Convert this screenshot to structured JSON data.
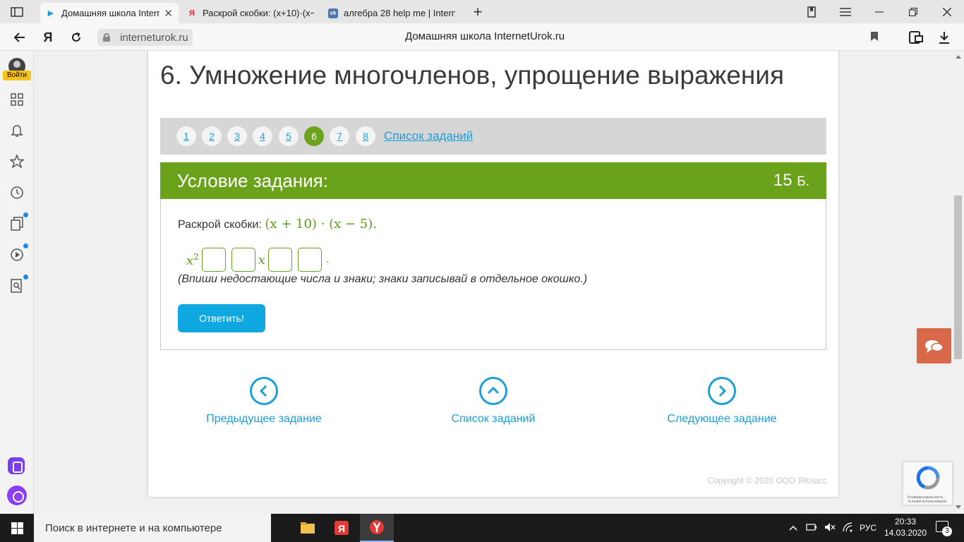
{
  "browser": {
    "tabs": [
      {
        "title": "Домашняя школа Intern",
        "favicon": "play-icon",
        "active": true
      },
      {
        "title": "Раскрой скобки: (x+10)·(x−",
        "favicon": "yandex-icon",
        "active": false
      },
      {
        "title": "алгебра 28 help me | Intern",
        "favicon": "vk-icon",
        "active": false
      }
    ],
    "url": "interneturok.ru",
    "page_title": "Домашняя школа InternetUrok.ru"
  },
  "sidebar": {
    "login_label": "Войти"
  },
  "lesson": {
    "title": "6. Умножение многочленов, упрощение выражения",
    "pages": [
      "1",
      "2",
      "3",
      "4",
      "5",
      "6",
      "7",
      "8"
    ],
    "active_page": "6",
    "task_list_link": "Список заданий"
  },
  "task": {
    "header": "Условие задания:",
    "points_value": "15",
    "points_unit": "Б.",
    "prompt": "Раскрой скобки:",
    "expression": "(x + 10) · (x − 5).",
    "answer_lead_var": "x",
    "answer_lead_exp": "2",
    "answer_mid_var": "x",
    "answer_end": ".",
    "hint": "(Впиши недостающие числа и знаки; знаки записывай в отдельное окошко.)",
    "submit_label": "Ответить!"
  },
  "bottom_nav": {
    "prev": "Предыдущее задание",
    "list": "Список заданий",
    "next": "Следующее задание"
  },
  "copyright": "Copyright © 2020 ООО ЯКласс",
  "recaptcha_text": "Конфиденциальность - Условия использования",
  "taskbar": {
    "search_placeholder": "Поиск в интернете и на компьютере",
    "lang": "РУС",
    "time": "20:33",
    "date": "14.03.2020",
    "notifications": "3"
  },
  "colors": {
    "accent_green": "#6aa21b",
    "link_blue": "#1c9fd8",
    "button_blue": "#0fa8e0",
    "chat_orange": "#d7694a"
  }
}
